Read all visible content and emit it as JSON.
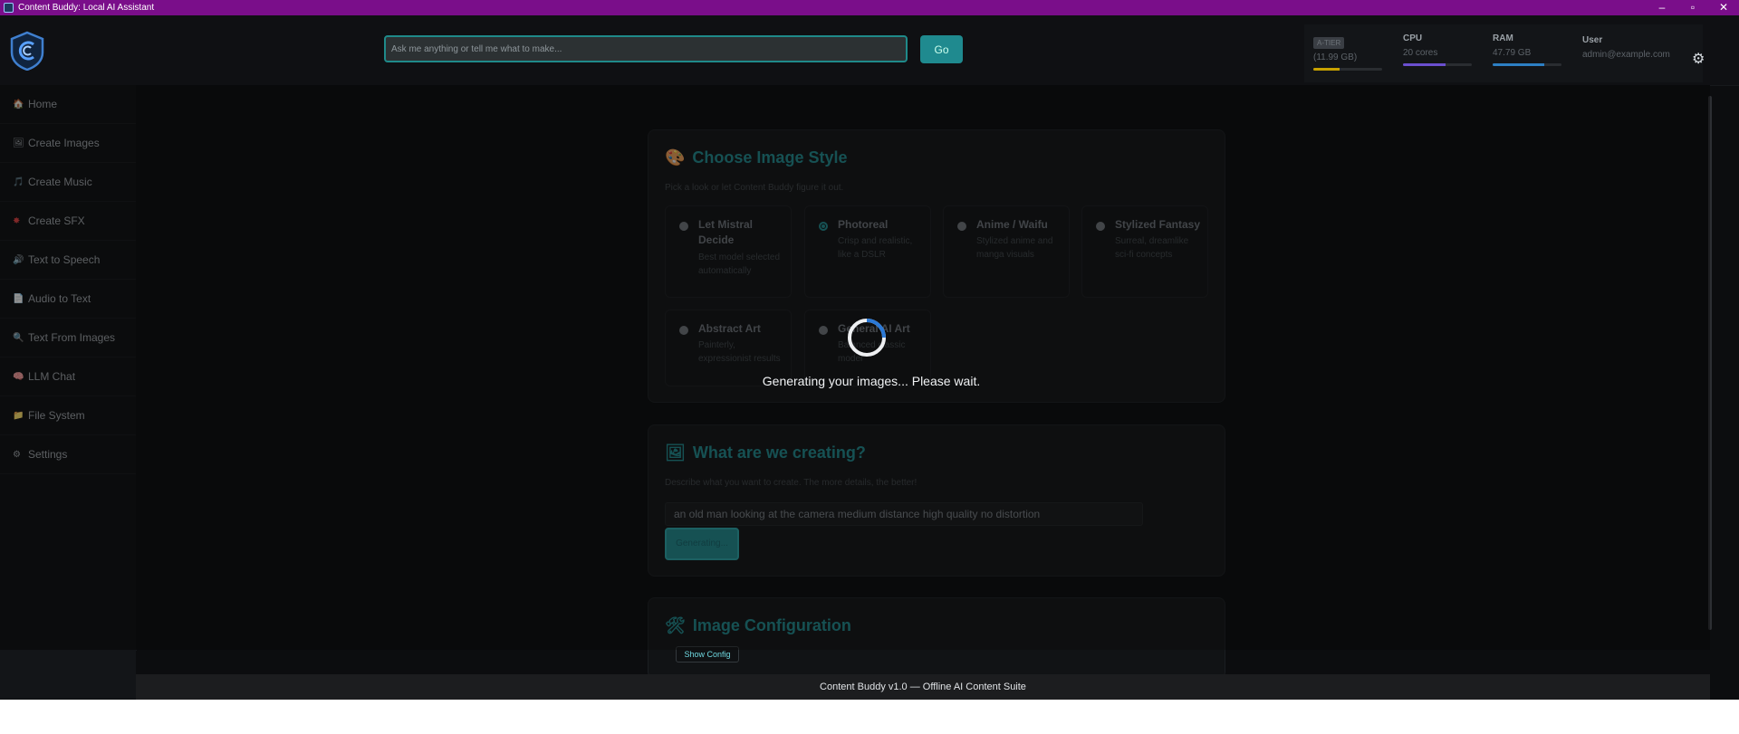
{
  "window": {
    "title": "Content Buddy: Local AI Assistant",
    "controls": [
      "–",
      "▫",
      "✕"
    ]
  },
  "header": {
    "search_placeholder": "Ask me anything or tell me what to make...",
    "go_label": "Go",
    "stats": {
      "tier": {
        "badge": "A-TIER",
        "value": "(11.99 GB)",
        "fill": 0.38,
        "color": "#c7a100"
      },
      "cpu": {
        "label": "CPU",
        "value": "20 cores",
        "fill": 0.62,
        "color": "#6b4fcf"
      },
      "ram": {
        "label": "RAM",
        "value": "47.79 GB",
        "fill": 0.75,
        "color": "#2d7fc4"
      },
      "user": {
        "label": "User",
        "value": "admin@example.com"
      }
    },
    "settings_icon": "gear-icon"
  },
  "sidebar": {
    "items": [
      {
        "icon": "🏠",
        "label": "Home"
      },
      {
        "icon": "🖼",
        "label": "Create Images"
      },
      {
        "icon": "🎵",
        "label": "Create Music"
      },
      {
        "icon": "✸",
        "label": "Create SFX"
      },
      {
        "icon": "🔊",
        "label": "Text to Speech"
      },
      {
        "icon": "📄",
        "label": "Audio to Text"
      },
      {
        "icon": "🔍",
        "label": "Text From Images"
      },
      {
        "icon": "🧠",
        "label": "LLM Chat"
      },
      {
        "icon": "📁",
        "label": "File System"
      },
      {
        "icon": "⚙",
        "label": "Settings"
      }
    ]
  },
  "style_card": {
    "icon": "🎨",
    "title": "Choose Image Style",
    "hint": "Pick a look or let Content Buddy figure it out.",
    "options": [
      {
        "name": "Let Mistral Decide",
        "desc": "Best model selected automatically",
        "selected": false
      },
      {
        "name": "Photoreal",
        "desc": "Crisp and realistic, like a DSLR",
        "selected": true
      },
      {
        "name": "Anime / Waifu",
        "desc": "Stylized anime and manga visuals",
        "selected": false
      },
      {
        "name": "Stylized Fantasy",
        "desc": "Surreal, dreamlike sci-fi concepts",
        "selected": false
      },
      {
        "name": "Abstract Art",
        "desc": "Painterly, expressionist results",
        "selected": false
      },
      {
        "name": "General AI Art",
        "desc": "Balanced classic model",
        "selected": false
      }
    ]
  },
  "create_card": {
    "icon": "🖼",
    "title": "What are we creating?",
    "hint": "Describe what you want to create. The more details, the better!",
    "prompt_value": "an old man looking at the camera medium distance high quality no distortion",
    "generate_label": "Generating..."
  },
  "config_card": {
    "icon": "🛠",
    "title": "Image Configuration",
    "show_config_label": "Show Config"
  },
  "overlay": {
    "text": "Generating your images... Please wait."
  },
  "footer": {
    "text": "Content Buddy v1.0 — Offline AI Content Suite"
  }
}
